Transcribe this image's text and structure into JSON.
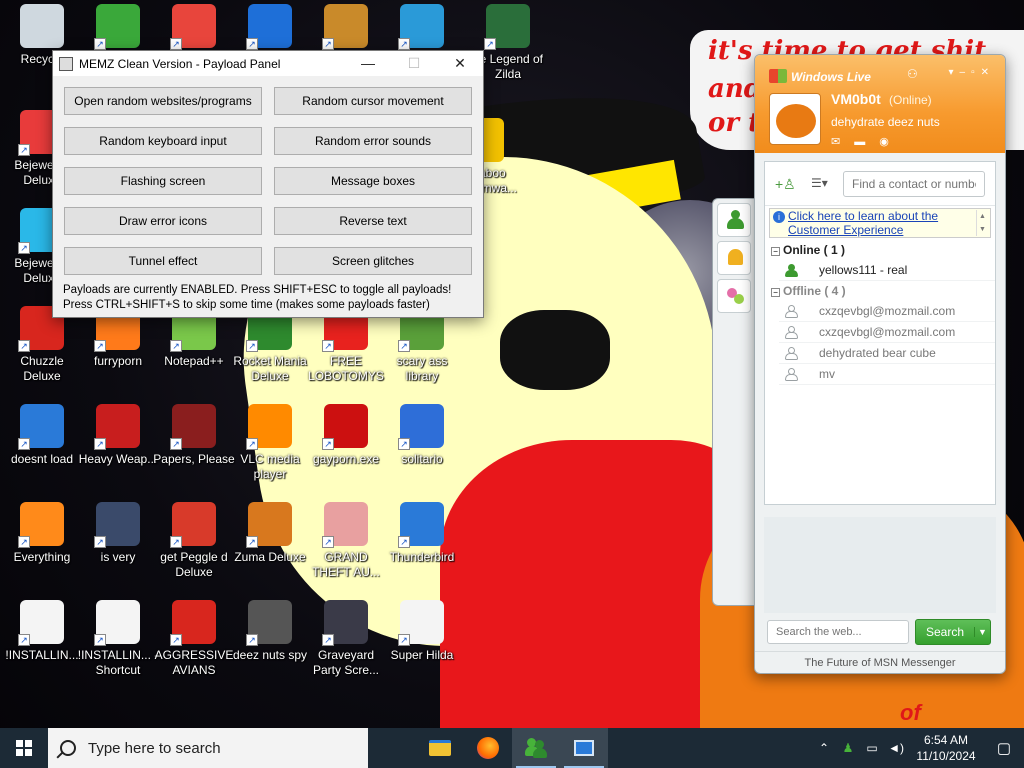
{
  "desktop": {
    "icons": [
      {
        "label": "Recycle",
        "color": "#cfd8df"
      },
      {
        "label": "",
        "color": "#3aa83a"
      },
      {
        "label": "",
        "color": "#e8453c"
      },
      {
        "label": "",
        "color": "#1e6fd8"
      },
      {
        "label": "",
        "color": "#c98a2a"
      },
      {
        "label": "",
        "color": "#2a9ad8"
      },
      {
        "label": "he Legend of Zilda",
        "color": "#2a6e3a"
      },
      {
        "label": "Bejeweled Deluxe",
        "color": "#e83b3b"
      },
      {
        "label": "Hildaboo Ransomwa...",
        "color": "#f2c100"
      },
      {
        "label": "Bejeweled Deluxe",
        "color": "#2ab8e8"
      },
      {
        "label": "Chuzzle Deluxe",
        "color": "#d8261e"
      },
      {
        "label": "furryporn",
        "color": "#ff7a1a"
      },
      {
        "label": "Notepad++",
        "color": "#7ac84a"
      },
      {
        "label": "Rocket Mania Deluxe",
        "color": "#2e8a2e"
      },
      {
        "label": "FREE LOBOTOMYS",
        "color": "#e8221e"
      },
      {
        "label": "scary ass library",
        "color": "#5aa03a"
      },
      {
        "label": "doesnt load",
        "color": "#2a7ad8"
      },
      {
        "label": "Heavy Weap...",
        "color": "#c81e1e"
      },
      {
        "label": "Papers, Please",
        "color": "#8a1e1e"
      },
      {
        "label": "VLC media player",
        "color": "#ff8a00"
      },
      {
        "label": "gayporn.exe",
        "color": "#cc1010"
      },
      {
        "label": "solitario",
        "color": "#2e6ed8"
      },
      {
        "label": "Everything",
        "color": "#ff8a1a"
      },
      {
        "label": "is very",
        "color": "#3a4a6a"
      },
      {
        "label": "get Peggle d Deluxe",
        "color": "#d83a2a"
      },
      {
        "label": "Zuma Deluxe",
        "color": "#d8781e"
      },
      {
        "label": "GRAND THEFT AU...",
        "color": "#e8a0a0"
      },
      {
        "label": "Thunderbird",
        "color": "#2a7ad8"
      },
      {
        "label": "!INSTALLIN...",
        "color": "#f4f4f4"
      },
      {
        "label": "!INSTALLIN... - Shortcut",
        "color": "#f4f4f4"
      },
      {
        "label": "AGGRESSIVE AVIANS",
        "color": "#d8261e"
      },
      {
        "label": "deez nuts spy",
        "color": "#555555"
      },
      {
        "label": "Graveyard Party Scre...",
        "color": "#3a3a48"
      },
      {
        "label": "Super Hilda",
        "color": "#f4f4f4"
      }
    ],
    "wallpaper_text": {
      "line1": "it's time to get shit",
      "line2": "and",
      "line3": "or t",
      "tail": "of"
    }
  },
  "memz": {
    "title": "MEMZ Clean Version - Payload Panel",
    "controls": {
      "minimize": "—",
      "maximize": "☐",
      "close": "✕"
    },
    "buttons": [
      "Open random websites/programs",
      "Random cursor movement",
      "Random keyboard input",
      "Random error sounds",
      "Flashing screen",
      "Message boxes",
      "Draw error icons",
      "Reverse text",
      "Tunnel effect",
      "Screen glitches"
    ],
    "status_line1": "Payloads are currently ENABLED. Press SHIFT+ESC to toggle all payloads!",
    "status_line2": "Press CTRL+SHIFT+S to skip some time (makes some payloads faster)"
  },
  "messenger": {
    "brand": "Windows Live",
    "username": "VM0b0t",
    "status": "(Online)",
    "personal_message": "dehydrate deez nuts",
    "find_placeholder": "Find a contact or numbe",
    "info_text": "Click here to learn about the Customer Experience",
    "groups": {
      "online": {
        "label": "Online ( 1 )",
        "contacts": [
          "yellows111 - real"
        ]
      },
      "offline": {
        "label": "Offline ( 4 )",
        "contacts": [
          "cxzqevbgl@mozmail.com",
          "cxzqevbgl@mozmail.com",
          "dehydrated bear cube",
          "mv"
        ]
      }
    },
    "search_placeholder": "Search the web...",
    "search_button": "Search",
    "footer": "The Future of MSN Messenger"
  },
  "taskbar": {
    "search_placeholder": "Type here to search",
    "apps": [
      "file-explorer",
      "firefox",
      "messenger",
      "memz"
    ],
    "time": "6:54 AM",
    "date": "11/10/2024"
  }
}
